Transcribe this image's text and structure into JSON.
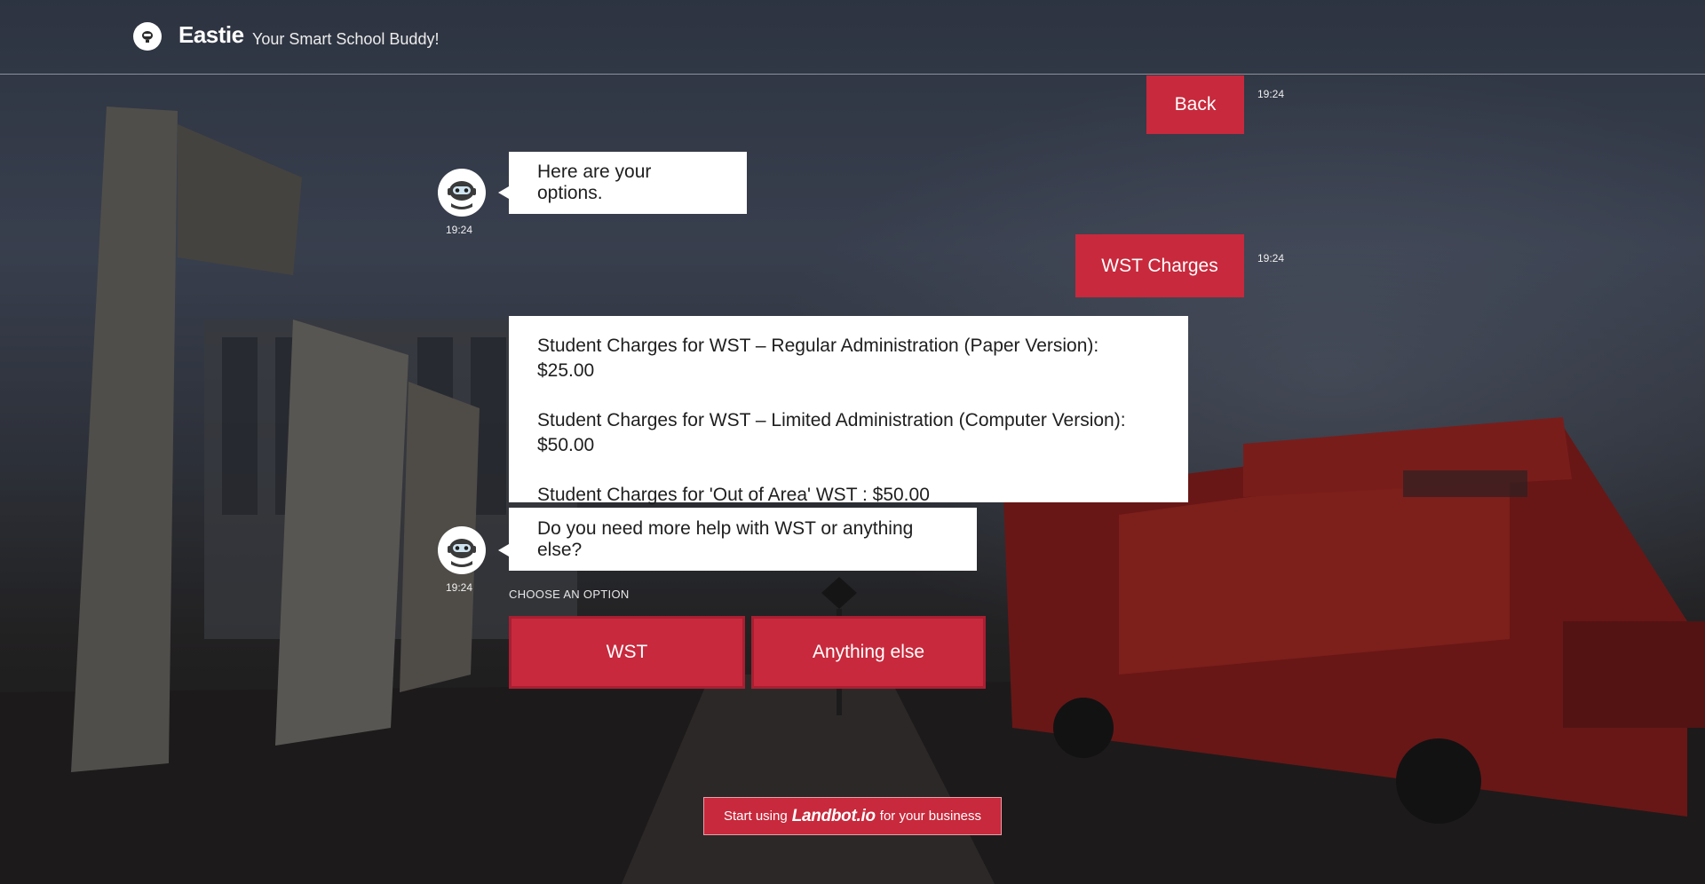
{
  "header": {
    "brand": "Eastie",
    "tagline": "Your Smart School Buddy!"
  },
  "messages": {
    "back": {
      "text": "Back",
      "time": "19:24"
    },
    "options_intro": {
      "text": "Here are your options.",
      "time": "19:24"
    },
    "wst_charges": {
      "text": "WST Charges",
      "time": "19:24"
    },
    "charges": {
      "lines": [
        "Student Charges for WST – Regular Administration (Paper Version): $25.00",
        "Student Charges for WST – Limited Administration (Computer Version): $50.00",
        "Student Charges for 'Out of Area' WST : $50.00"
      ]
    },
    "more_help": {
      "text": "Do you need more help with WST or anything else?",
      "time": "19:24"
    }
  },
  "options": {
    "label": "CHOOSE AN OPTION",
    "items": [
      "WST",
      "Anything else"
    ]
  },
  "promo": {
    "prefix": "Start using",
    "brand": "Landbot.io",
    "suffix": "for your business"
  },
  "colors": {
    "accent": "#c8293c",
    "bubble": "#ffffff"
  },
  "icons": {
    "logo": "robot-icon",
    "avatar": "robot-avatar-icon"
  }
}
